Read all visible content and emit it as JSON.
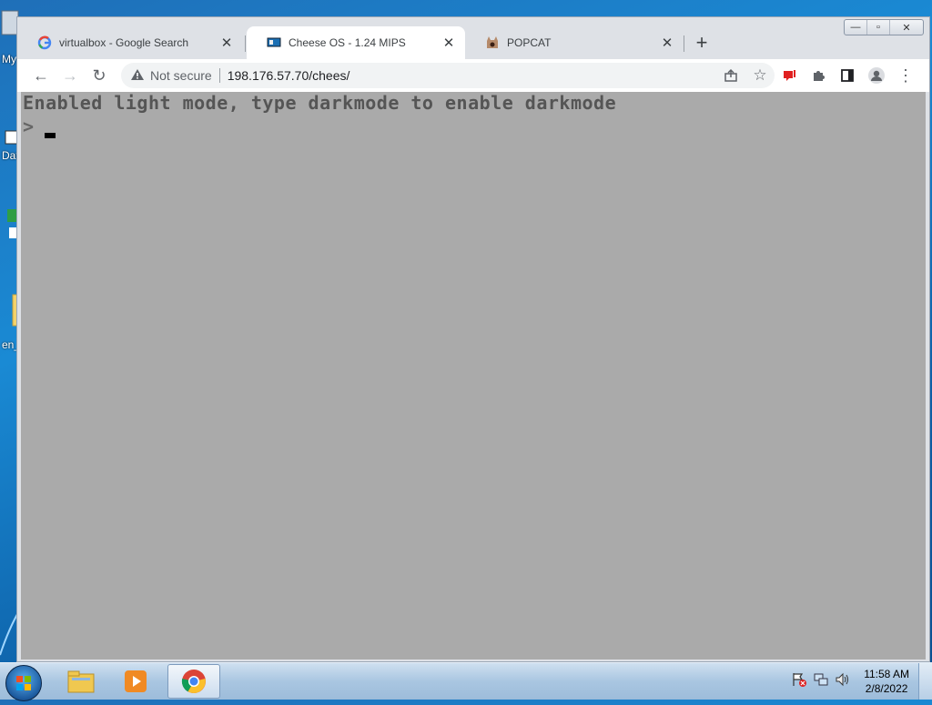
{
  "desktop": {
    "labels": [
      "My",
      "Dat",
      "en_"
    ]
  },
  "window": {
    "controls": {
      "minimize": "—",
      "maximize": "▫",
      "close": "✕"
    }
  },
  "tabs": [
    {
      "title": "virtualbox - Google Search",
      "favicon": "google-g-icon",
      "active": false
    },
    {
      "title": "Cheese OS - 1.24 MIPS",
      "favicon": "computer-icon",
      "active": true
    },
    {
      "title": "POPCAT",
      "favicon": "popcat-icon",
      "active": false
    }
  ],
  "toolbar": {
    "back": "←",
    "forward": "→",
    "reload": "↻",
    "security_text": "Not secure",
    "url": "198.176.57.70/chees/"
  },
  "terminal": {
    "message": "Enabled light mode, type darkmode to enable darkmode",
    "prompt": ">",
    "background": "#aaaaaa",
    "text_color": "#555555"
  },
  "taskbar": {
    "time": "11:58 AM",
    "date": "2/8/2022"
  },
  "colors": {
    "desktop": "#1a8ad4",
    "tab_strip": "#dee1e6",
    "security_warning": "#5f6368"
  }
}
